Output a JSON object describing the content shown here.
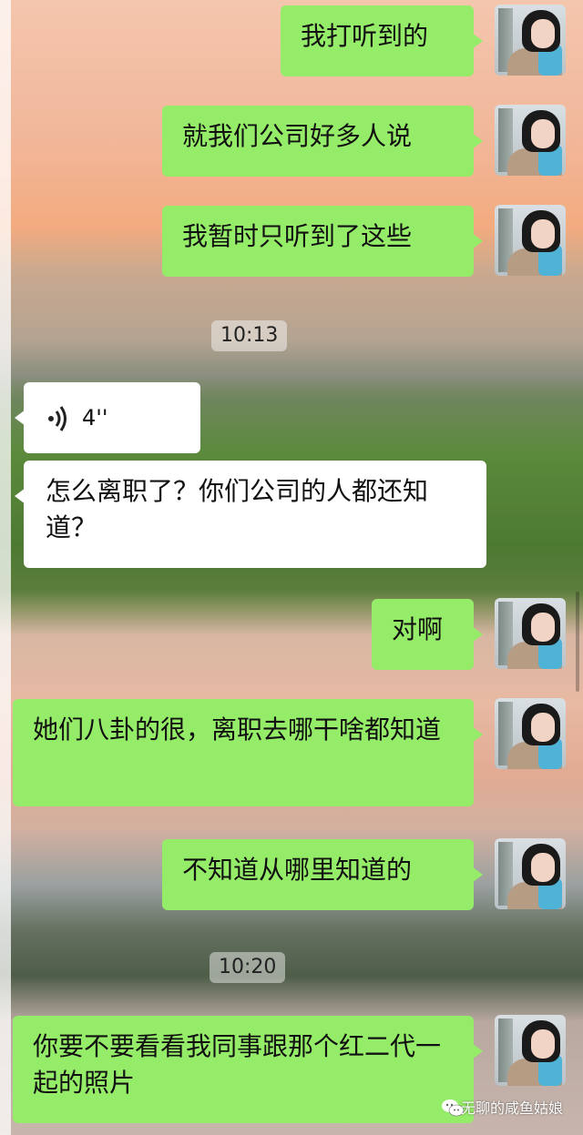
{
  "messages": [
    {
      "side": "right",
      "text": "我打听到的"
    },
    {
      "side": "right",
      "text": "就我们公司好多人说"
    },
    {
      "side": "right",
      "text": "我暂时只听到了这些"
    },
    {
      "type": "time",
      "text": "10:13"
    },
    {
      "side": "left",
      "type": "voice",
      "duration": "4''"
    },
    {
      "side": "left",
      "text": "怎么离职了？你们公司的人都还知道？"
    },
    {
      "side": "right",
      "text": "对啊"
    },
    {
      "side": "right",
      "text": "她们八卦的很，离职去哪干啥都知道"
    },
    {
      "side": "right",
      "text": "不知道从哪里知道的"
    },
    {
      "type": "time",
      "text": "10:20"
    },
    {
      "side": "right",
      "text": "你要不要看看我同事跟那个红二代一起的照片"
    }
  ],
  "watermark": "无聊的咸鱼姑娘",
  "colors": {
    "sent_bubble": "#95ec69",
    "received_bubble": "#ffffff"
  },
  "icons": [
    "avatar",
    "voice-wave-icon",
    "wechat-logo-icon"
  ]
}
